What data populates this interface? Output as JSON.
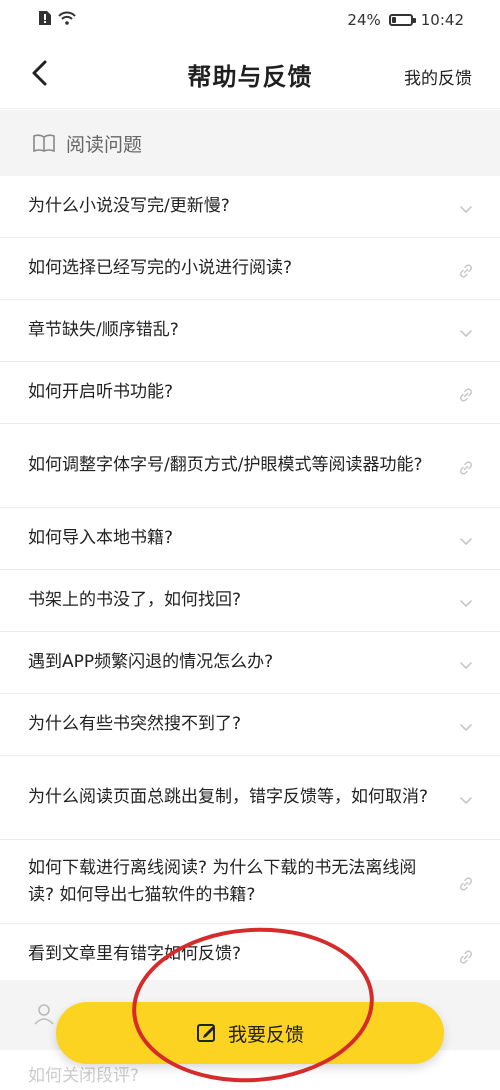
{
  "status_bar": {
    "battery": "24%",
    "battery_level": 0.24,
    "time": "10:42"
  },
  "nav": {
    "title": "帮助与反馈",
    "right_link": "我的反馈"
  },
  "section": {
    "title": "阅读问题",
    "icon": "book-icon"
  },
  "faq": [
    {
      "text": "为什么小说没写完/更新慢?",
      "icon": "chevron-down-icon"
    },
    {
      "text": "如何选择已经写完的小说进行阅读?",
      "icon": "link-icon"
    },
    {
      "text": "章节缺失/顺序错乱?",
      "icon": "chevron-down-icon"
    },
    {
      "text": "如何开启听书功能?",
      "icon": "link-icon"
    },
    {
      "text": "如何调整字体字号/翻页方式/护眼模式等阅读器功能?",
      "icon": "link-icon"
    },
    {
      "text": "如何导入本地书籍?",
      "icon": "chevron-down-icon"
    },
    {
      "text": "书架上的书没了，如何找回?",
      "icon": "chevron-down-icon"
    },
    {
      "text": "遇到APP频繁闪退的情况怎么办?",
      "icon": "chevron-down-icon"
    },
    {
      "text": "为什么有些书突然搜不到了?",
      "icon": "chevron-down-icon"
    },
    {
      "text": "为什么阅读页面总跳出复制，错字反馈等，如何取消?",
      "icon": "chevron-down-icon"
    },
    {
      "text": "如何下载进行离线阅读? 为什么下载的书无法离线阅读? 如何导出七猫软件的书籍?",
      "icon": "link-icon"
    },
    {
      "text": "看到文章里有错字如何反馈?",
      "icon": "link-icon"
    }
  ],
  "section2": {
    "icon": "user-icon"
  },
  "partial_row": {
    "text": "如何关闭段评?"
  },
  "feedback_button": {
    "label": "我要反馈",
    "icon": "edit-icon"
  },
  "colors": {
    "accent": "#fcd321",
    "annotation": "#d62b2b"
  }
}
